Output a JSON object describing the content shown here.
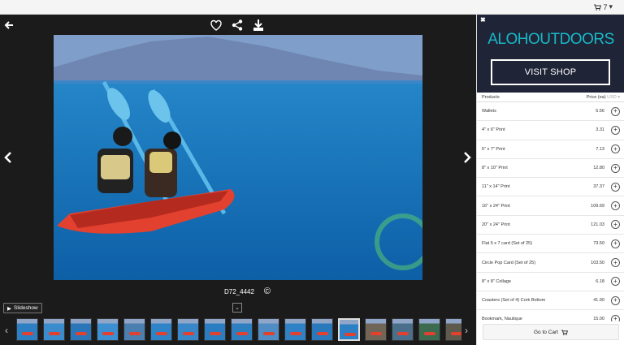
{
  "header": {
    "cart_count": "7",
    "cart_caret": "▾"
  },
  "viewer": {
    "photo_id": "D72_4442",
    "copyright_symbol": "©",
    "slideshow_label": "Slideshow"
  },
  "shop": {
    "brand": "ALOHOUTDOORS",
    "visit_label": "VISIT SHOP",
    "products_header": "Products",
    "price_header": "Price (ea)",
    "currency": "USD ▾",
    "items": [
      {
        "name": "Wallets",
        "price": "5.56"
      },
      {
        "name": "4\" x 6\" Print",
        "price": "3.31"
      },
      {
        "name": "5\" x 7\" Print",
        "price": "7.13"
      },
      {
        "name": "8\" x 10\" Print",
        "price": "12.80"
      },
      {
        "name": "11\" x 14\" Print",
        "price": "37.37"
      },
      {
        "name": "16\" x 24\" Print",
        "price": "109.69"
      },
      {
        "name": "20\" x 24\" Print",
        "price": "121.03"
      },
      {
        "name": "Flat 5 x 7 card (Set of 25)",
        "price": "73.50"
      },
      {
        "name": "Circle Pop Card (Set of 25)",
        "price": "103.50"
      },
      {
        "name": "8\" x 8\" Collage",
        "price": "6.18"
      },
      {
        "name": "Coasters (Set of 4) Cork Bottom",
        "price": "41.90"
      },
      {
        "name": "Bookmark, Nautique",
        "price": "15.00"
      }
    ],
    "cart_label": "Go to Cart"
  },
  "colors": {
    "viewer_bg": "#1b1b1b",
    "banner_bg": "#1f2436",
    "brand": "#18b9c9"
  }
}
